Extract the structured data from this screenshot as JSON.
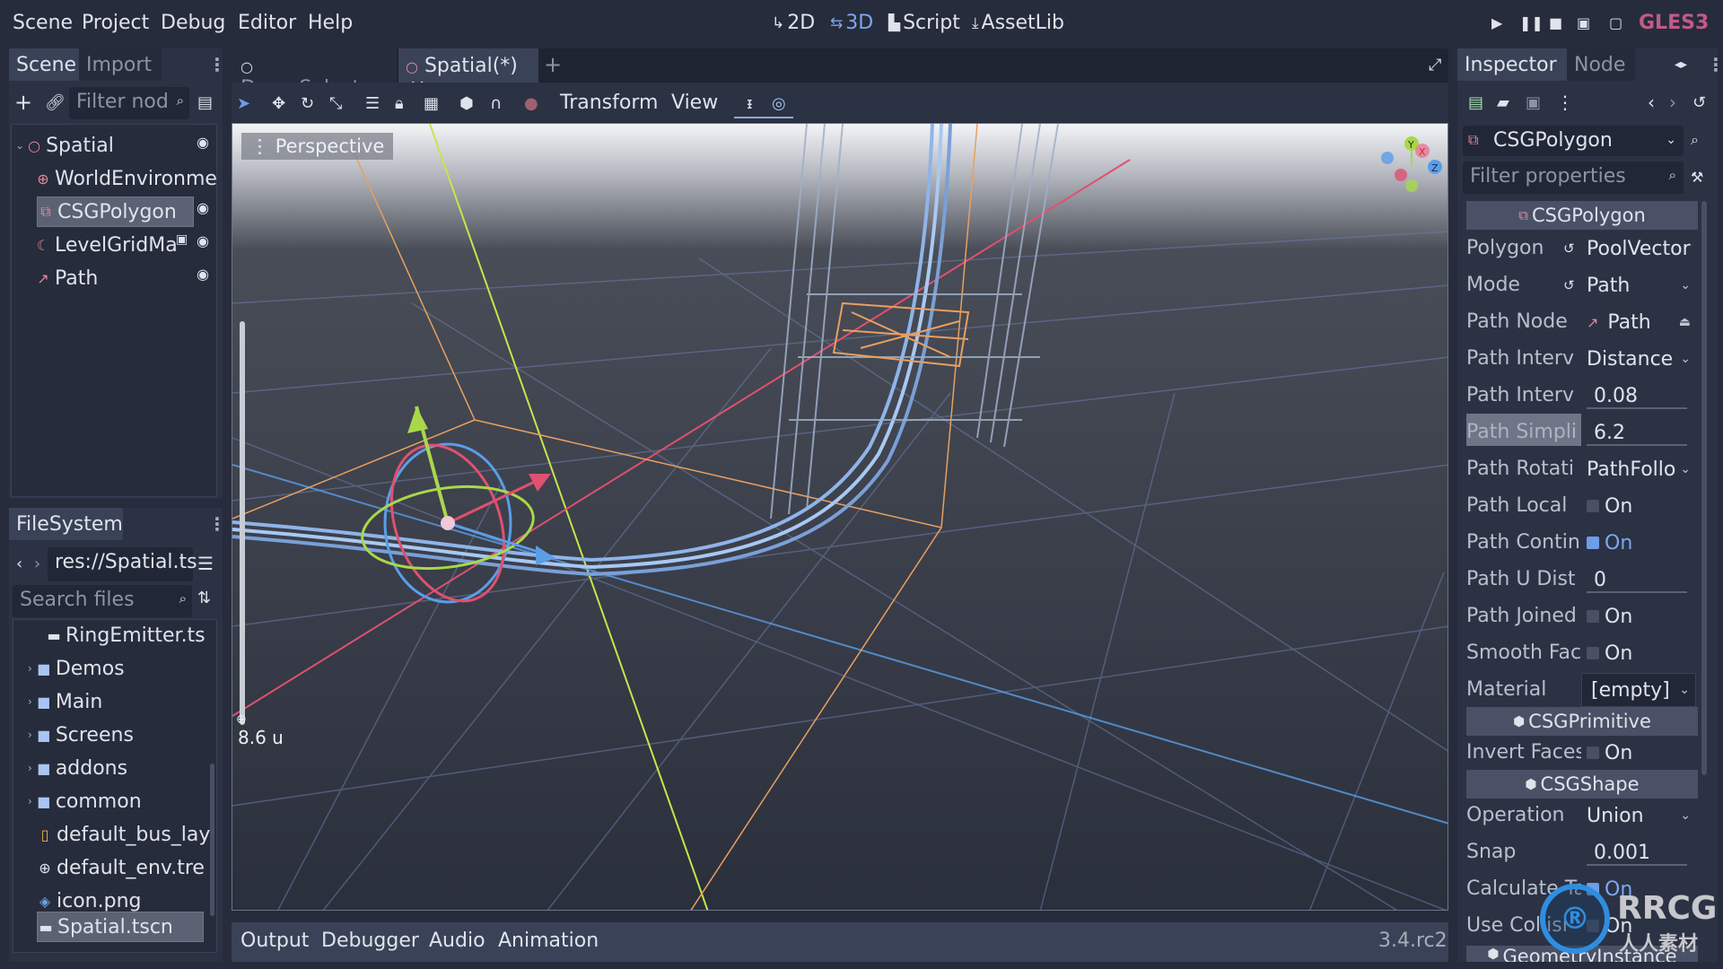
{
  "menubar": {
    "items": [
      "Scene",
      "Project",
      "Debug",
      "Editor",
      "Help"
    ],
    "workspaces": [
      {
        "label": "2D",
        "icon": "2d-icon",
        "active": false
      },
      {
        "label": "3D",
        "icon": "3d-icon",
        "active": true
      },
      {
        "label": "Script",
        "icon": "script-icon",
        "active": false
      },
      {
        "label": "AssetLib",
        "icon": "assetlib-icon",
        "active": false
      }
    ],
    "run_buttons": [
      "play",
      "pause",
      "stop",
      "play-scene",
      "play-custom-scene"
    ],
    "renderer": "GLES3",
    "renderer_color": "#c15a86"
  },
  "scene_dock": {
    "tabs": [
      "Scene",
      "Import"
    ],
    "active_tab": "Scene",
    "filter_placeholder": "Filter nod",
    "tree": [
      {
        "name": "Spatial",
        "icon": "spatial-icon",
        "depth": 0,
        "expanded": true,
        "visible_toggle": true,
        "selected": false
      },
      {
        "name": "WorldEnvironme",
        "icon": "world-environment-icon",
        "depth": 1,
        "visible_toggle": false,
        "selected": false
      },
      {
        "name": "CSGPolygon",
        "icon": "csg-polygon-icon",
        "depth": 1,
        "visible_toggle": true,
        "selected": true
      },
      {
        "name": "LevelGridMa",
        "icon": "gridmap-icon",
        "depth": 1,
        "visible_toggle": true,
        "instanced": true,
        "selected": false
      },
      {
        "name": "Path",
        "icon": "path-icon",
        "depth": 1,
        "visible_toggle": true,
        "selected": false
      }
    ]
  },
  "filesystem_dock": {
    "title": "FileSystem",
    "path": "res://Spatial.ts",
    "search_placeholder": "Search files",
    "items": [
      {
        "name": "RingEmitter.ts",
        "type": "scene",
        "depth": 2
      },
      {
        "name": "Demos",
        "type": "folder",
        "depth": 1
      },
      {
        "name": "Main",
        "type": "folder",
        "depth": 1
      },
      {
        "name": "Screens",
        "type": "folder",
        "depth": 1
      },
      {
        "name": "addons",
        "type": "folder",
        "depth": 1
      },
      {
        "name": "common",
        "type": "folder",
        "depth": 1
      },
      {
        "name": "default_bus_lay",
        "type": "audio-bus",
        "depth": 1
      },
      {
        "name": "default_env.tre",
        "type": "environment",
        "depth": 1
      },
      {
        "name": "icon.png",
        "type": "image",
        "depth": 1
      },
      {
        "name": "Spatial.tscn",
        "type": "scene",
        "depth": 1,
        "selected": true
      }
    ]
  },
  "editor_tabs": [
    {
      "label": "DemoSelector",
      "active": false
    },
    {
      "label": "Spatial(*)",
      "active": true,
      "closable": true
    }
  ],
  "viewport_toolbar": {
    "tools": [
      "select",
      "move",
      "rotate",
      "scale",
      "list-select",
      "lock",
      "group",
      "local-space",
      "snap",
      "camera-preview"
    ],
    "menus": [
      "Transform",
      "View"
    ],
    "extra": [
      "path-edit",
      "path-select"
    ]
  },
  "viewport": {
    "perspective_label": "Perspective",
    "zoom_readout": "8.6 u",
    "gizmo_axes": [
      "Y",
      "X",
      "Z"
    ]
  },
  "bottom_panel": {
    "tabs": [
      "Output",
      "Debugger",
      "Audio",
      "Animation"
    ],
    "version": "3.4.rc2"
  },
  "inspector": {
    "tabs": [
      "Inspector",
      "Node"
    ],
    "active_tab": "Inspector",
    "object": "CSGPolygon",
    "filter_placeholder": "Filter properties",
    "sections": [
      {
        "title": "CSGPolygon",
        "properties": [
          {
            "label": "Polygon",
            "value": "PoolVector",
            "kind": "resource",
            "revert": true
          },
          {
            "label": "Mode",
            "value": "Path",
            "kind": "enum",
            "revert": true
          },
          {
            "label": "Path Node",
            "value": "Path",
            "kind": "nodepath"
          },
          {
            "label": "Path Interv",
            "value": "Distance",
            "kind": "enum"
          },
          {
            "label": "Path Interv",
            "value": "0.08",
            "kind": "number"
          },
          {
            "label": "Path Simpli",
            "value": "6.2",
            "kind": "number",
            "highlighted": true
          },
          {
            "label": "Path Rotati",
            "value": "PathFollo",
            "kind": "enum"
          },
          {
            "label": "Path Local",
            "value": "On",
            "kind": "bool",
            "checked": false
          },
          {
            "label": "Path Contin",
            "value": "On",
            "kind": "bool",
            "checked": true
          },
          {
            "label": "Path U Dist",
            "value": "0",
            "kind": "number"
          },
          {
            "label": "Path Joined",
            "value": "On",
            "kind": "bool",
            "checked": false
          },
          {
            "label": "Smooth Fac",
            "value": "On",
            "kind": "bool",
            "checked": false
          },
          {
            "label": "Material",
            "value": "[empty]",
            "kind": "enum"
          }
        ]
      },
      {
        "title": "CSGPrimitive",
        "properties": [
          {
            "label": "Invert Faces",
            "value": "On",
            "kind": "bool",
            "checked": false
          }
        ]
      },
      {
        "title": "CSGShape",
        "properties": [
          {
            "label": "Operation",
            "value": "Union",
            "kind": "enum"
          },
          {
            "label": "Snap",
            "value": "0.001",
            "kind": "number"
          },
          {
            "label": "Calculate Ta",
            "value": "On",
            "kind": "bool",
            "checked": true
          },
          {
            "label": "Use Collisi",
            "value": "On",
            "kind": "bool",
            "checked": false
          }
        ]
      },
      {
        "title": "GeometryInstance",
        "properties": []
      }
    ]
  },
  "watermark": {
    "text": "RRCG",
    "subtext": "人人素材"
  }
}
